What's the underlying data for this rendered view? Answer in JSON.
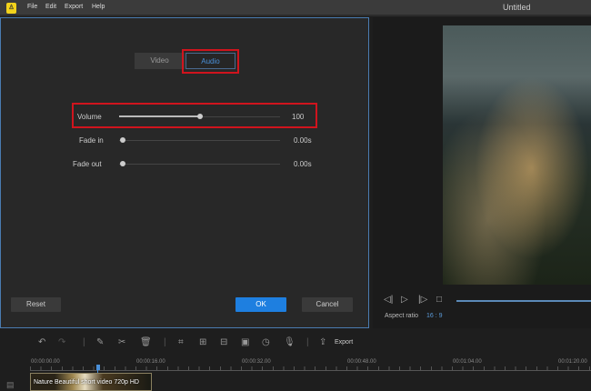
{
  "titlebar": {
    "logo": "ApowerEdit",
    "menu": [
      "File",
      "Edit",
      "Export",
      "Help"
    ],
    "title": "Untitled"
  },
  "dialog": {
    "tabs": [
      {
        "label": "Video",
        "active": false
      },
      {
        "label": "Audio",
        "active": true
      }
    ],
    "volume": {
      "label": "Volume",
      "value": "100",
      "fraction": 0.5
    },
    "fade_in": {
      "label": "Fade in",
      "value": "0.00s",
      "fraction": 0
    },
    "fade_out": {
      "label": "Fade out",
      "value": "0.00s",
      "fraction": 0
    },
    "reset_label": "Reset",
    "ok_label": "OK",
    "cancel_label": "Cancel",
    "accent": "#1e7fe0",
    "highlight": "#d0141d"
  },
  "preview": {
    "aspect_label": "Aspect ratio",
    "aspect_value": "16 : 9"
  },
  "toolbar": {
    "export_label": "Export"
  },
  "timeline": {
    "ticks": [
      "00:00:00.00",
      "00:00:16.00",
      "00:00:32.00",
      "00:00:48.00",
      "00:01:04.00",
      "00:01:20.00"
    ],
    "clip_title": "Nature Beautiful short video 720p HD"
  }
}
